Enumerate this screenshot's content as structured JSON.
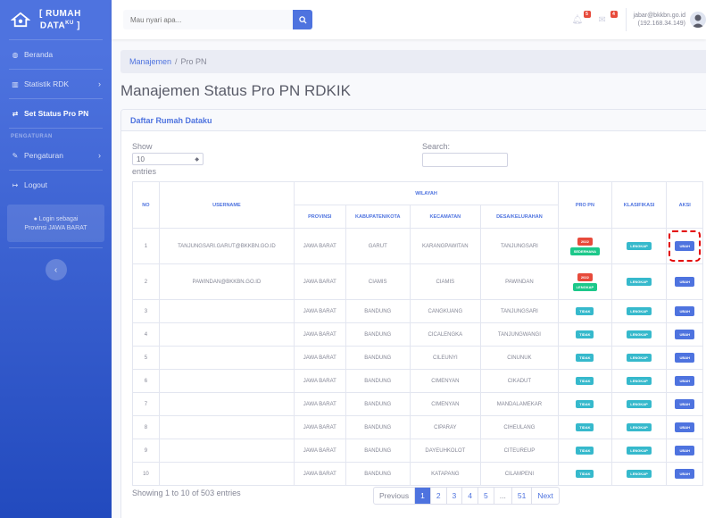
{
  "brand": {
    "line1": "[ RUMAH",
    "line2": "DATA",
    "sup": "KU",
    "line2_end": " ]"
  },
  "sidebar": {
    "items": [
      {
        "label": "Beranda",
        "icon": "dashboard-icon"
      },
      {
        "label": "Statistik RDK",
        "icon": "chart-icon"
      },
      {
        "label": "Set Status Pro PN",
        "icon": "exchange-icon"
      }
    ],
    "heading": "PENGATURAN",
    "settings": {
      "label": "Pengaturan",
      "icon": "wrench-icon"
    },
    "logout": {
      "label": "Logout",
      "icon": "logout-icon"
    },
    "login_as": {
      "line1": "Login sebagai",
      "line2": "Provinsi JAWA BARAT"
    },
    "toggle": "‹"
  },
  "topbar": {
    "search_placeholder": "Mau nyari apa...",
    "alerts_count": "5",
    "messages_count": "4",
    "user_email": "jabar@bkkbn.go.id",
    "user_ip": "(192.168.34.149)"
  },
  "breadcrumb": {
    "link": "Manajemen",
    "current": "Pro PN"
  },
  "page_title": "Manajemen Status Pro PN RDKIK",
  "card": {
    "title": "Daftar Rumah Dataku",
    "show_label": "Show",
    "show_value": "10",
    "entries_label": "entries",
    "search_label": "Search:"
  },
  "table": {
    "headers": {
      "no": "NO",
      "username": "USERNAME",
      "wilayah": "WILAYAH",
      "provinsi": "PROVINSI",
      "kabupaten": "KABUPATEN/KOTA",
      "kecamatan": "KECAMATAN",
      "desa": "DESA/KELURAHAN",
      "pro_pn": "PRO PN",
      "klasifikasi": "KLASIFIKASI",
      "aksi": "AKSI"
    },
    "rows": [
      {
        "no": "1",
        "username": "TANJUNGSARI.GARUT@BKKBN.GO.ID",
        "provinsi": "JAWA BARAT",
        "kabupaten": "GARUT",
        "kecamatan": "KARANGPAWITAN",
        "desa": "TANJUNGSARI",
        "pro_pn": "2022",
        "pro_pn_sub": "SEDERHANA",
        "klasifikasi": "LENGKAP",
        "aksi": "UBAH"
      },
      {
        "no": "2",
        "username": "PAWINDAN@BKKBN.GO.ID",
        "provinsi": "JAWA BARAT",
        "kabupaten": "CIAMIS",
        "kecamatan": "CIAMIS",
        "desa": "PAWINDAN",
        "pro_pn": "2022",
        "pro_pn_sub": "LENGKAP",
        "klasifikasi": "LENGKAP",
        "aksi": "UBAH"
      },
      {
        "no": "3",
        "username": "",
        "provinsi": "JAWA BARAT",
        "kabupaten": "BANDUNG",
        "kecamatan": "CANGKUANG",
        "desa": "TANJUNGSARI",
        "pro_pn": "TIDAK",
        "klasifikasi": "LENGKAP",
        "aksi": "UBAH"
      },
      {
        "no": "4",
        "username": "",
        "provinsi": "JAWA BARAT",
        "kabupaten": "BANDUNG",
        "kecamatan": "CICALENGKA",
        "desa": "TANJUNGWANGI",
        "pro_pn": "TIDAK",
        "klasifikasi": "LENGKAP",
        "aksi": "UBAH"
      },
      {
        "no": "5",
        "username": "",
        "provinsi": "JAWA BARAT",
        "kabupaten": "BANDUNG",
        "kecamatan": "CILEUNYI",
        "desa": "CINUNUK",
        "pro_pn": "TIDAK",
        "klasifikasi": "LENGKAP",
        "aksi": "UBAH"
      },
      {
        "no": "6",
        "username": "",
        "provinsi": "JAWA BARAT",
        "kabupaten": "BANDUNG",
        "kecamatan": "CIMENYAN",
        "desa": "CIKADUT",
        "pro_pn": "TIDAK",
        "klasifikasi": "LENGKAP",
        "aksi": "UBAH"
      },
      {
        "no": "7",
        "username": "",
        "provinsi": "JAWA BARAT",
        "kabupaten": "BANDUNG",
        "kecamatan": "CIMENYAN",
        "desa": "MANDALAMEKAR",
        "pro_pn": "TIDAK",
        "klasifikasi": "LENGKAP",
        "aksi": "UBAH"
      },
      {
        "no": "8",
        "username": "",
        "provinsi": "JAWA BARAT",
        "kabupaten": "BANDUNG",
        "kecamatan": "CIPARAY",
        "desa": "CIHEULANG",
        "pro_pn": "TIDAK",
        "klasifikasi": "LENGKAP",
        "aksi": "UBAH"
      },
      {
        "no": "9",
        "username": "",
        "provinsi": "JAWA BARAT",
        "kabupaten": "BANDUNG",
        "kecamatan": "DAYEUHKOLOT",
        "desa": "CITEUREUP",
        "pro_pn": "TIDAK",
        "klasifikasi": "LENGKAP",
        "aksi": "UBAH"
      },
      {
        "no": "10",
        "username": "",
        "provinsi": "JAWA BARAT",
        "kabupaten": "BANDUNG",
        "kecamatan": "KATAPANG",
        "desa": "CILAMPENI",
        "pro_pn": "TIDAK",
        "klasifikasi": "LENGKAP",
        "aksi": "UBAH"
      }
    ]
  },
  "footer": {
    "info": "Showing 1 to 10 of 503 entries",
    "pagination": [
      "Previous",
      "1",
      "2",
      "3",
      "4",
      "5",
      "...",
      "51",
      "Next"
    ],
    "active_page": "1"
  },
  "colors": {
    "primary": "#4e73df",
    "red": "#e74a3b",
    "green": "#1cc88a",
    "teal": "#36b9cc",
    "highlight": "#e30000"
  }
}
